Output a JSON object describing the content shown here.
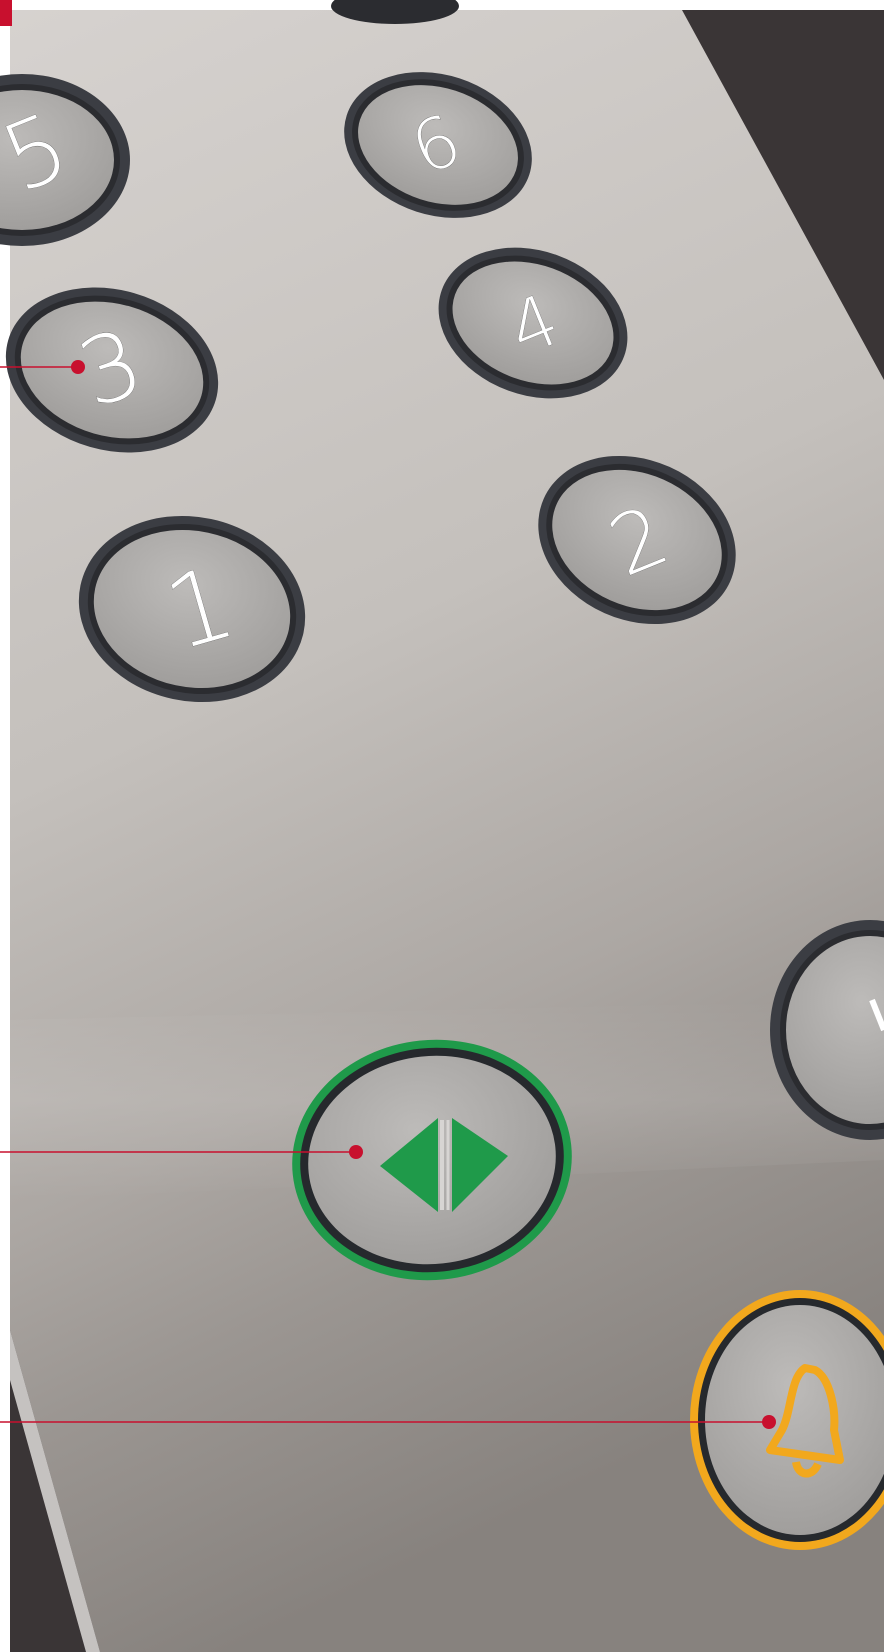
{
  "scene": {
    "subject": "elevator-car-operating-panel",
    "colors": {
      "backdrop": "#3a3536",
      "panel_light": "#cfcbc8",
      "panel_dark": "#8e8985",
      "button_face": "#acaaa8",
      "button_rim": "#2e2f33",
      "accent_red": "#c8102e",
      "door_open_green": "#1f9a4a",
      "alarm_amber": "#f2a81d"
    }
  },
  "buttons": {
    "floor_5": {
      "label": "5",
      "icon": "digit-5"
    },
    "floor_6": {
      "label": "6",
      "icon": "digit-6"
    },
    "floor_3": {
      "label": "3",
      "icon": "digit-3"
    },
    "floor_4": {
      "label": "4",
      "icon": "digit-4"
    },
    "floor_1": {
      "label": "1",
      "icon": "digit-1"
    },
    "floor_2": {
      "label": "2",
      "icon": "digit-2"
    },
    "door_open": {
      "icon": "door-open-arrows-icon",
      "ring_color": "#1f9a4a"
    },
    "alarm": {
      "icon": "bell-icon",
      "ring_color": "#f2a81d"
    }
  },
  "callouts": [
    "leader-to-floor-button",
    "leader-to-door-open-button",
    "leader-to-alarm-button"
  ]
}
